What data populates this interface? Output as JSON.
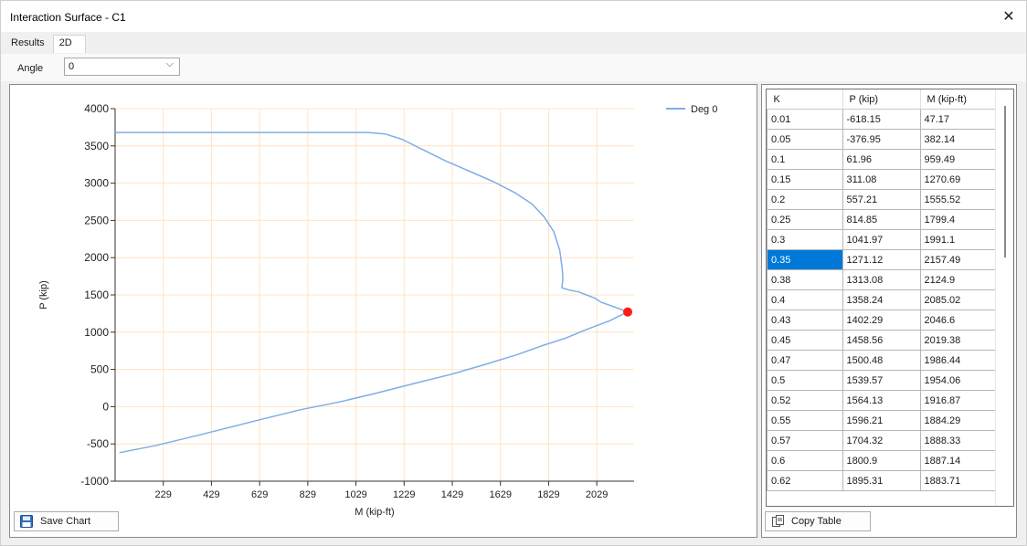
{
  "window": {
    "title": "Interaction Surface - C1",
    "close_glyph": "✕"
  },
  "tabs": [
    {
      "label": "Results"
    },
    {
      "label": "2D"
    }
  ],
  "angle": {
    "label": "Angle",
    "value": "0"
  },
  "buttons": {
    "save_chart": "Save Chart",
    "copy_table": "Copy Table"
  },
  "table": {
    "headers": [
      "K",
      "P (kip)",
      "M (kip-ft)"
    ],
    "rows": [
      [
        "0.01",
        "-618.15",
        "47.17"
      ],
      [
        "0.05",
        "-376.95",
        "382.14"
      ],
      [
        "0.1",
        "61.96",
        "959.49"
      ],
      [
        "0.15",
        "311.08",
        "1270.69"
      ],
      [
        "0.2",
        "557.21",
        "1555.52"
      ],
      [
        "0.25",
        "814.85",
        "1799.4"
      ],
      [
        "0.3",
        "1041.97",
        "1991.1"
      ],
      [
        "0.35",
        "1271.12",
        "2157.49"
      ],
      [
        "0.38",
        "1313.08",
        "2124.9"
      ],
      [
        "0.4",
        "1358.24",
        "2085.02"
      ],
      [
        "0.43",
        "1402.29",
        "2046.6"
      ],
      [
        "0.45",
        "1458.56",
        "2019.38"
      ],
      [
        "0.47",
        "1500.48",
        "1986.44"
      ],
      [
        "0.5",
        "1539.57",
        "1954.06"
      ],
      [
        "0.52",
        "1564.13",
        "1916.87"
      ],
      [
        "0.55",
        "1596.21",
        "1884.29"
      ],
      [
        "0.57",
        "1704.32",
        "1888.33"
      ],
      [
        "0.6",
        "1800.9",
        "1887.14"
      ],
      [
        "0.62",
        "1895.31",
        "1883.71"
      ]
    ],
    "selected_row": 7
  },
  "chart_data": {
    "type": "line",
    "title": "",
    "xlabel": "M (kip-ft)",
    "ylabel": "P (kip)",
    "xlim": [
      29,
      2184
    ],
    "ylim": [
      -1000,
      4000
    ],
    "xticks": [
      229,
      429,
      629,
      829,
      1029,
      1229,
      1429,
      1629,
      1829,
      2029
    ],
    "yticks": [
      4000,
      3500,
      3000,
      2500,
      2000,
      1500,
      1000,
      500,
      0,
      -500,
      -1000
    ],
    "grid": true,
    "grid_color": "#ffe4c2",
    "legend": {
      "position": "top-right"
    },
    "series": [
      {
        "name": "Deg 0",
        "color": "#7eaee6",
        "points": [
          [
            47,
            -618
          ],
          [
            200,
            -520
          ],
          [
            382,
            -377
          ],
          [
            600,
            -200
          ],
          [
            800,
            -40
          ],
          [
            959,
            62
          ],
          [
            1100,
            170
          ],
          [
            1271,
            311
          ],
          [
            1420,
            430
          ],
          [
            1556,
            557
          ],
          [
            1700,
            700
          ],
          [
            1799,
            815
          ],
          [
            1900,
            920
          ],
          [
            1991,
            1042
          ],
          [
            2080,
            1150
          ],
          [
            2157,
            1271
          ],
          [
            2125,
            1313
          ],
          [
            2085,
            1358
          ],
          [
            2047,
            1402
          ],
          [
            2019,
            1459
          ],
          [
            1986,
            1500
          ],
          [
            1954,
            1540
          ],
          [
            1917,
            1564
          ],
          [
            1884,
            1596
          ],
          [
            1888,
            1704
          ],
          [
            1887,
            1801
          ],
          [
            1884,
            1895
          ],
          [
            1875,
            2100
          ],
          [
            1850,
            2350
          ],
          [
            1810,
            2550
          ],
          [
            1760,
            2720
          ],
          [
            1690,
            2870
          ],
          [
            1600,
            3020
          ],
          [
            1500,
            3160
          ],
          [
            1400,
            3300
          ],
          [
            1300,
            3460
          ],
          [
            1220,
            3590
          ],
          [
            1150,
            3660
          ],
          [
            1080,
            3680
          ],
          [
            29,
            3680
          ]
        ]
      }
    ],
    "highlight_point": {
      "x": 2157.49,
      "y": 1271.12,
      "color": "#ff1a1a"
    }
  }
}
